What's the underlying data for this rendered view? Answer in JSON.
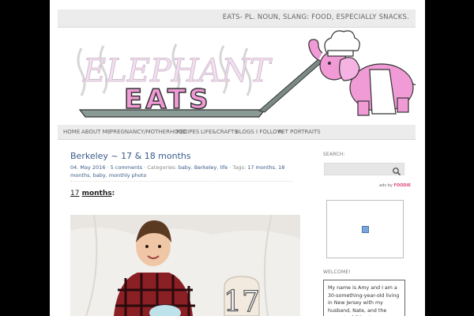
{
  "header": {
    "tagline": "EATS- PL. NOUN, SLANG: FOOD, ESPECIALLY SNACKS.",
    "logo_line1": "ELEPHANT",
    "logo_line2": "EATS"
  },
  "nav": {
    "items": [
      {
        "label": "HOME"
      },
      {
        "label": "ABOUT ME"
      },
      {
        "label": "PREGNANCY/MOTHERHOOD"
      },
      {
        "label": "RECIPES"
      },
      {
        "label": "LIFE&CRAFTS"
      },
      {
        "label": "BLOGS I FOLLOW"
      },
      {
        "label": "PET PORTRAITS"
      }
    ]
  },
  "post": {
    "title": "Berkeley ~ 17 & 18 months",
    "date": "04. May 2016",
    "comments": "5 comments",
    "categories_label": "Categories:",
    "categories": [
      "baby",
      "Berkeley",
      "life"
    ],
    "tags_label": "Tags:",
    "tags": [
      "17 months",
      "18 months",
      "baby",
      "monthly photo"
    ],
    "subheading_num": "17",
    "subheading_word": "months",
    "subheading_colon": ":",
    "photo_sign_number": "17"
  },
  "sidebar": {
    "search_label": "SEARCH:",
    "search_placeholder": "",
    "foodie_prefix": "adv by",
    "foodie_brand": "FOODIE",
    "welcome_label": "WELCOME!",
    "welcome_text": "My name is Amy and I am a 30-something-year-old living in New Jersey with my husband, Nate, and the newest addition to our family, baby Berkeley! I love"
  },
  "colors": {
    "page_background": "#ffffff",
    "outer_background": "#000000",
    "link_blue": "#3a5a8a",
    "logo_pink": "#f09ad6"
  }
}
